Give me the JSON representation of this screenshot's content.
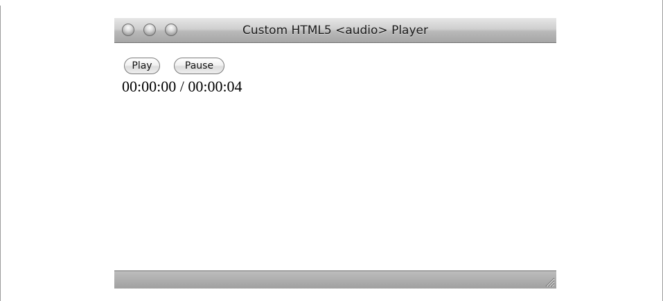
{
  "window": {
    "title": "Custom HTML5 <audio> Player"
  },
  "controls": {
    "play_label": "Play",
    "pause_label": "Pause",
    "time_display": "00:00:00 / 00:00:04"
  },
  "icons": {
    "close": "close-icon",
    "minimize": "minimize-icon",
    "zoom": "zoom-icon",
    "resize": "resize-grip-icon"
  },
  "colors": {
    "titlebar_top": "#e6e6e6",
    "titlebar_bottom": "#a6a6a6",
    "statusbar": "#a0a0a0",
    "content_background": "#ffffff"
  }
}
